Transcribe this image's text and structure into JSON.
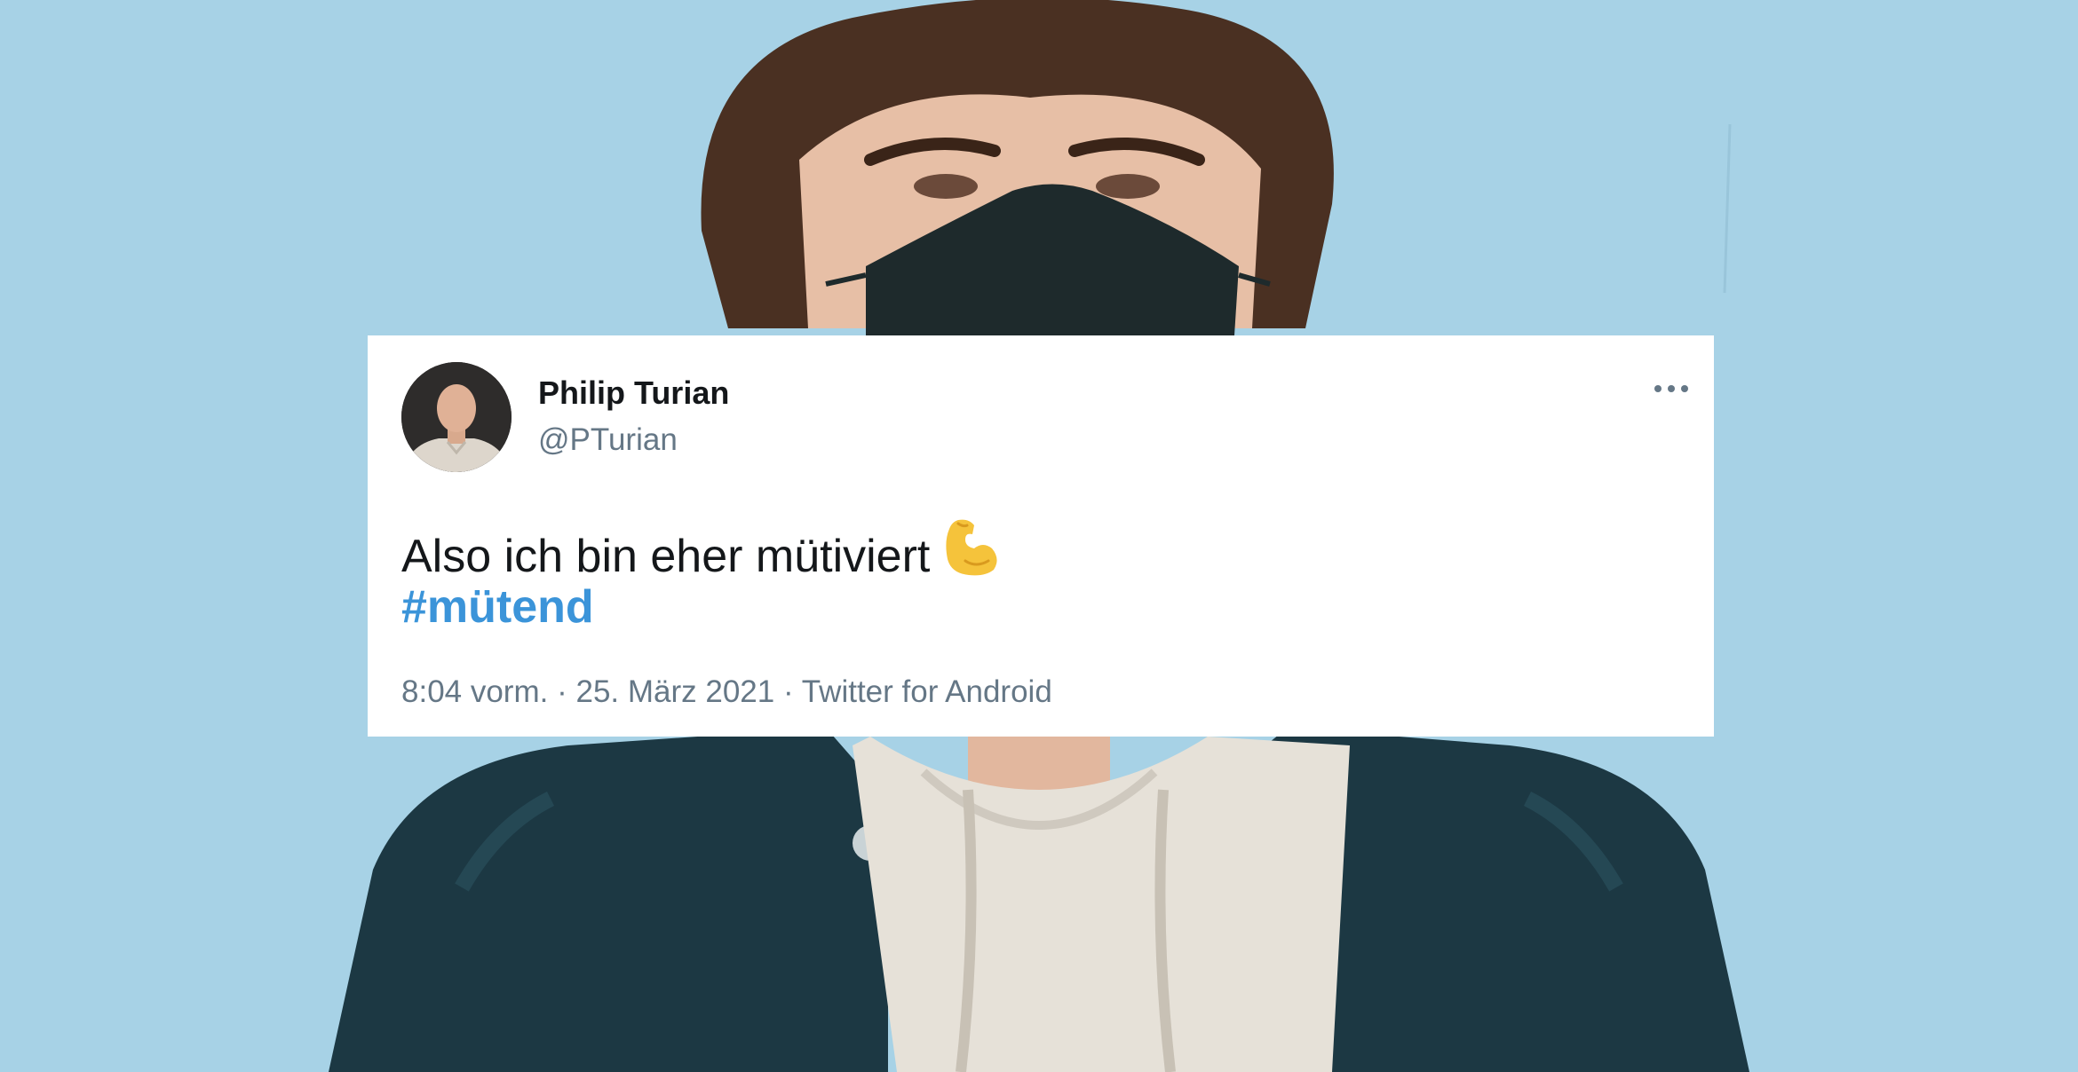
{
  "tweet": {
    "display_name": "Philip Turian",
    "handle": "@PTurian",
    "text": "Also ich bin eher mütiviert",
    "emoji": "flexed-biceps",
    "hashtag": "#mütend",
    "time": "8:04 vorm.",
    "separator": "·",
    "date": "25. März 2021",
    "source": "Twitter for Android",
    "more_icon": "more-horizontal-icon"
  },
  "colors": {
    "background_wall": "#a9d3e7",
    "card_background": "#ffffff",
    "name_color": "#14171a",
    "secondary_text": "#657786",
    "hashtag_color": "#3b94d9",
    "mask_color": "#1e2a2c",
    "jacket_color": "#1d3a45",
    "hoodie_color": "#e6e2da"
  }
}
